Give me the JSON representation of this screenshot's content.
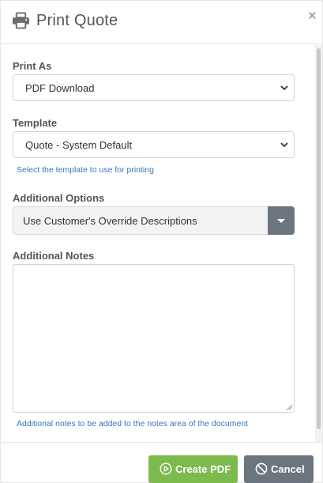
{
  "header": {
    "title": "Print Quote",
    "icon": "printer-icon",
    "close_label": "×"
  },
  "form": {
    "print_as": {
      "label": "Print As",
      "value": "PDF Download"
    },
    "template": {
      "label": "Template",
      "value": "Quote - System Default",
      "help": "Select the template to use for printing"
    },
    "additional_options": {
      "label": "Additional Options",
      "value": "Use Customer's Override Descriptions"
    },
    "additional_notes": {
      "label": "Additional Notes",
      "value": "",
      "help": "Additional notes to be added to the notes area of the document"
    }
  },
  "footer": {
    "create_pdf_label": "Create PDF",
    "cancel_label": "Cancel"
  },
  "colors": {
    "create_button": "#7cba4e",
    "cancel_button": "#6c757d",
    "help_text": "#3a77b7"
  }
}
